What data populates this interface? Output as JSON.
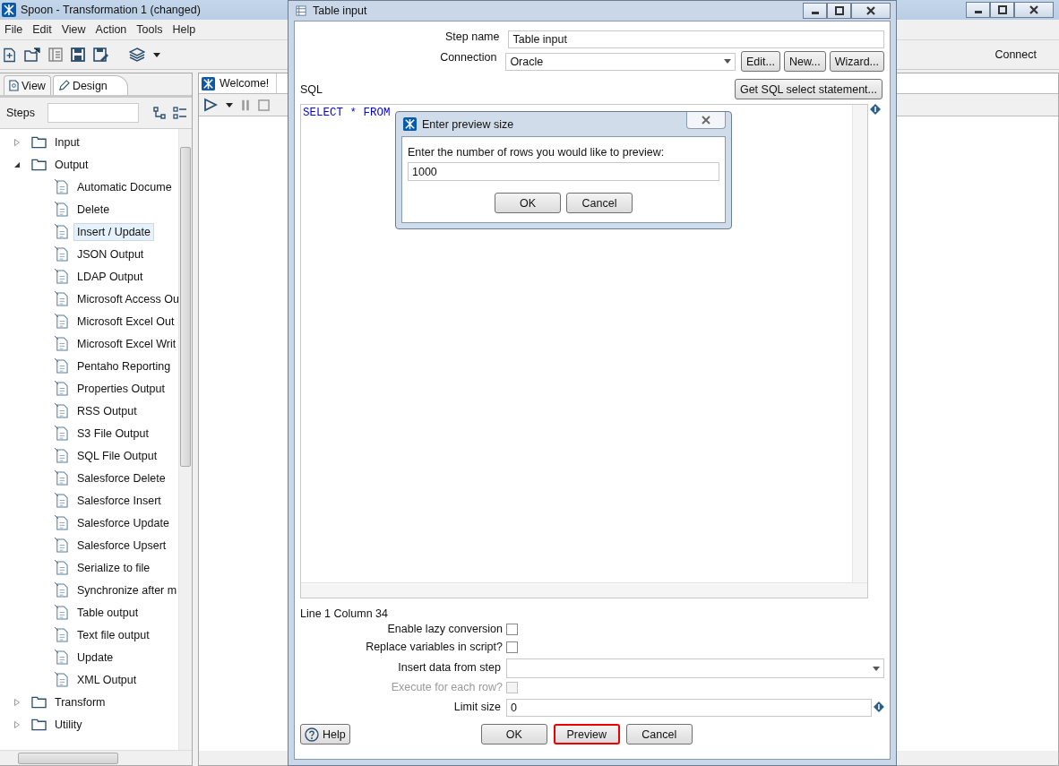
{
  "window": {
    "title": "Spoon - Transformation 1 (changed)"
  },
  "menu": [
    "File",
    "Edit",
    "View",
    "Action",
    "Tools",
    "Help"
  ],
  "toolbar": {
    "connect_label": "Connect"
  },
  "perspective_tabs": [
    {
      "label": "View",
      "selected": false
    },
    {
      "label": "Design",
      "selected": true
    }
  ],
  "steps": {
    "label": "Steps"
  },
  "tree": [
    {
      "label": "Input",
      "expanded": false
    },
    {
      "label": "Output",
      "expanded": true,
      "children": [
        {
          "label": "Automatic Docume",
          "selected": false
        },
        {
          "label": "Delete",
          "selected": false
        },
        {
          "label": "Insert / Update",
          "selected": true
        },
        {
          "label": "JSON Output",
          "selected": false
        },
        {
          "label": "LDAP Output",
          "selected": false
        },
        {
          "label": "Microsoft Access Ou",
          "selected": false
        },
        {
          "label": "Microsoft Excel Out",
          "selected": false
        },
        {
          "label": "Microsoft Excel Writ",
          "selected": false
        },
        {
          "label": "Pentaho Reporting",
          "selected": false
        },
        {
          "label": "Properties Output",
          "selected": false
        },
        {
          "label": "RSS Output",
          "selected": false
        },
        {
          "label": "S3 File Output",
          "selected": false
        },
        {
          "label": "SQL File Output",
          "selected": false
        },
        {
          "label": "Salesforce Delete",
          "selected": false
        },
        {
          "label": "Salesforce Insert",
          "selected": false
        },
        {
          "label": "Salesforce Update",
          "selected": false
        },
        {
          "label": "Salesforce Upsert",
          "selected": false
        },
        {
          "label": "Serialize to file",
          "selected": false
        },
        {
          "label": "Synchronize after m",
          "selected": false
        },
        {
          "label": "Table output",
          "selected": false
        },
        {
          "label": "Text file output",
          "selected": false
        },
        {
          "label": "Update",
          "selected": false
        },
        {
          "label": "XML Output",
          "selected": false
        }
      ]
    },
    {
      "label": "Transform",
      "expanded": false
    },
    {
      "label": "Utility",
      "expanded": false
    }
  ],
  "canvas_tabs": [
    {
      "label": "Welcome!"
    }
  ],
  "dialog": {
    "title": "Table input",
    "step_name_label": "Step name",
    "step_name": "Table input",
    "connection_label": "Connection",
    "connection": "Oracle",
    "connection_buttons": [
      "Edit...",
      "New...",
      "Wizard..."
    ],
    "sql_label": "SQL",
    "get_sql_button": "Get SQL select statement...",
    "sql": "SELECT * FROM",
    "position": "Line 1 Column 34",
    "options": [
      {
        "kind": "checkbox",
        "label": "Enable lazy conversion",
        "checked": false,
        "disabled": false
      },
      {
        "kind": "checkbox",
        "label": "Replace variables in script?",
        "checked": false,
        "disabled": false
      },
      {
        "kind": "dropdown",
        "label": "Insert data from step"
      },
      {
        "kind": "checkbox",
        "label": "Execute for each row?",
        "checked": false,
        "disabled": true
      },
      {
        "kind": "text",
        "label": "Limit size",
        "value": "0"
      }
    ],
    "help_button": "Help",
    "buttons": [
      {
        "label": "OK",
        "focused": false
      },
      {
        "label": "Preview",
        "focused": true
      },
      {
        "label": "Cancel",
        "focused": false
      }
    ]
  },
  "preview_dialog": {
    "title": "Enter preview size",
    "prompt": "Enter the number of rows you would like to preview:",
    "value": "1000",
    "buttons": [
      "OK",
      "Cancel"
    ]
  }
}
